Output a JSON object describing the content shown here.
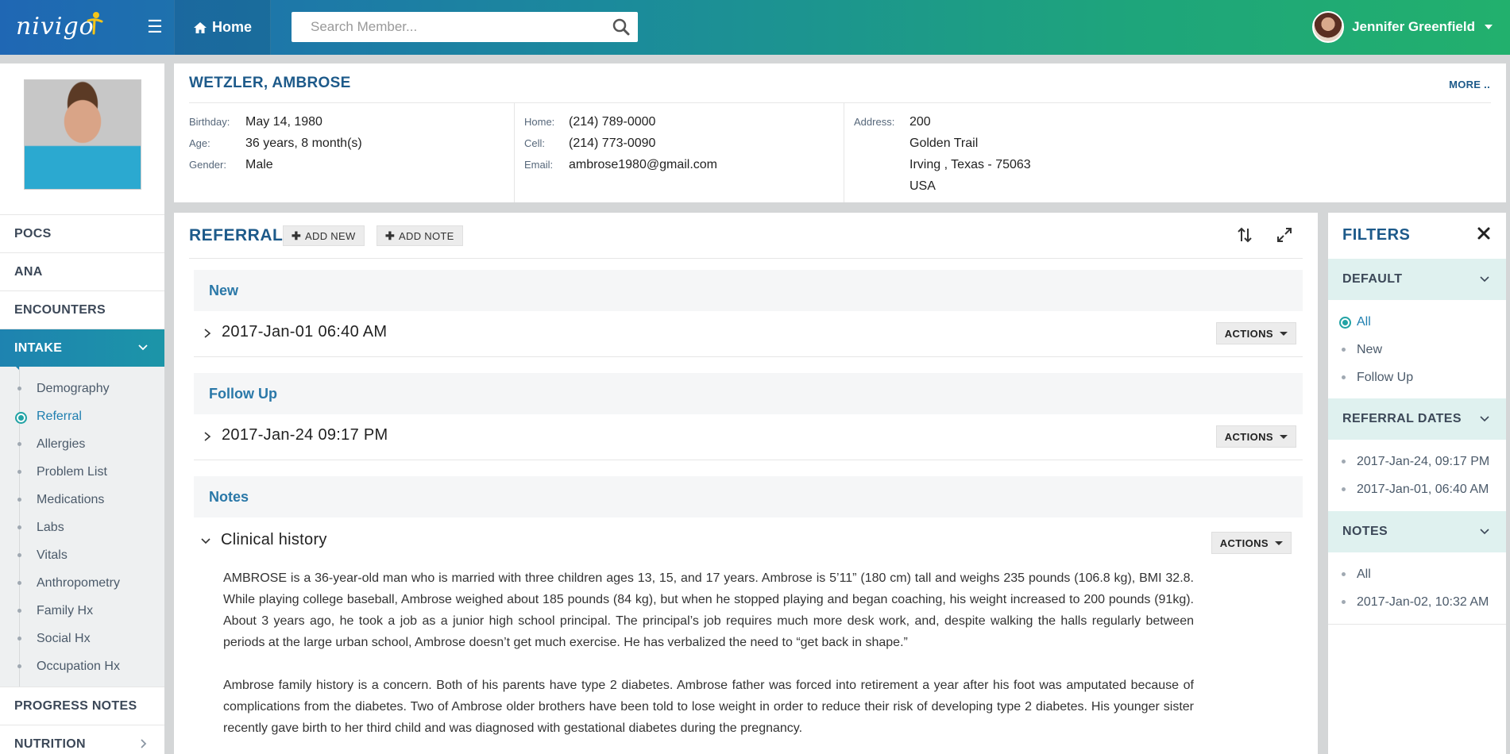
{
  "brand": {
    "logo_text": "nivigo"
  },
  "topbar": {
    "home_label": "Home",
    "search_placeholder": "Search Member...",
    "user_name": "Jennifer Greenfield"
  },
  "patient": {
    "name": "WETZLER, AMBROSE",
    "more_label": "MORE ..",
    "birthday_label": "Birthday:",
    "birthday": "May 14, 1980",
    "age_label": "Age:",
    "age": "36 years, 8 month(s)",
    "gender_label": "Gender:",
    "gender": "Male",
    "home_label": "Home:",
    "home_phone": "(214) 789-0000",
    "cell_label": "Cell:",
    "cell_phone": "(214) 773-0090",
    "email_label": "Email:",
    "email": "ambrose1980@gmail.com",
    "address_label": "Address:",
    "address": [
      "200",
      "Golden Trail",
      "Irving , Texas - 75063",
      "USA"
    ]
  },
  "sidebar": {
    "items": [
      {
        "label": "POCS"
      },
      {
        "label": "ANA"
      },
      {
        "label": "ENCOUNTERS"
      },
      {
        "label": "INTAKE"
      }
    ],
    "intake_sub": [
      {
        "label": "Demography"
      },
      {
        "label": "Referral"
      },
      {
        "label": "Allergies"
      },
      {
        "label": "Problem List"
      },
      {
        "label": "Medications"
      },
      {
        "label": "Labs"
      },
      {
        "label": "Vitals"
      },
      {
        "label": "Anthropometry"
      },
      {
        "label": "Family Hx"
      },
      {
        "label": "Social Hx"
      },
      {
        "label": "Occupation Hx"
      }
    ],
    "bottom_items": [
      {
        "label": "PROGRESS NOTES"
      },
      {
        "label": "NUTRITION"
      }
    ]
  },
  "main": {
    "title": "REFERRAL",
    "add_new_label": "ADD NEW",
    "add_note_label": "ADD NOTE",
    "actions_label": "ACTIONS",
    "groups": [
      {
        "label": "New",
        "entry": "2017-Jan-01 06:40 AM"
      },
      {
        "label": "Follow Up",
        "entry": "2017-Jan-24 09:17 PM"
      },
      {
        "label": "Notes",
        "entry": "Clinical history"
      }
    ],
    "note_paragraphs": [
      "AMBROSE is a 36-year-old man who is married with three children ages 13, 15, and 17 years. Ambrose is 5’11” (180 cm) tall and weighs 235 pounds (106.8 kg), BMI 32.8. While playing college baseball, Ambrose weighed about 185 pounds (84 kg), but when he stopped playing and began coaching, his weight increased to 200 pounds (91kg). About 3 years ago, he took a job as a junior high school principal. The principal’s job requires much more desk work, and, despite walking the halls regularly between periods at the large urban school, Ambrose doesn’t get much exercise. He has verbalized the need to “get back in shape.”",
      "Ambrose family history is a concern. Both of his parents have type 2 diabetes. Ambrose father was forced into retirement a year after his foot was amputated because of complications from the diabetes. Two of Ambrose older brothers have been told to lose weight in order to reduce their risk of developing type 2 diabetes. His younger sister recently gave birth to her third child and was diagnosed with gestational diabetes during the pregnancy."
    ]
  },
  "filters": {
    "title": "FILTERS",
    "default_label": "DEFAULT",
    "default_items": [
      "All",
      "New",
      "Follow Up"
    ],
    "dates_label": "REFERRAL DATES",
    "date_items": [
      "2017-Jan-24, 09:17 PM",
      "2017-Jan-01, 06:40 AM"
    ],
    "notes_label": "NOTES",
    "notes_items": [
      "All",
      "2017-Jan-02, 10:32 AM"
    ]
  }
}
